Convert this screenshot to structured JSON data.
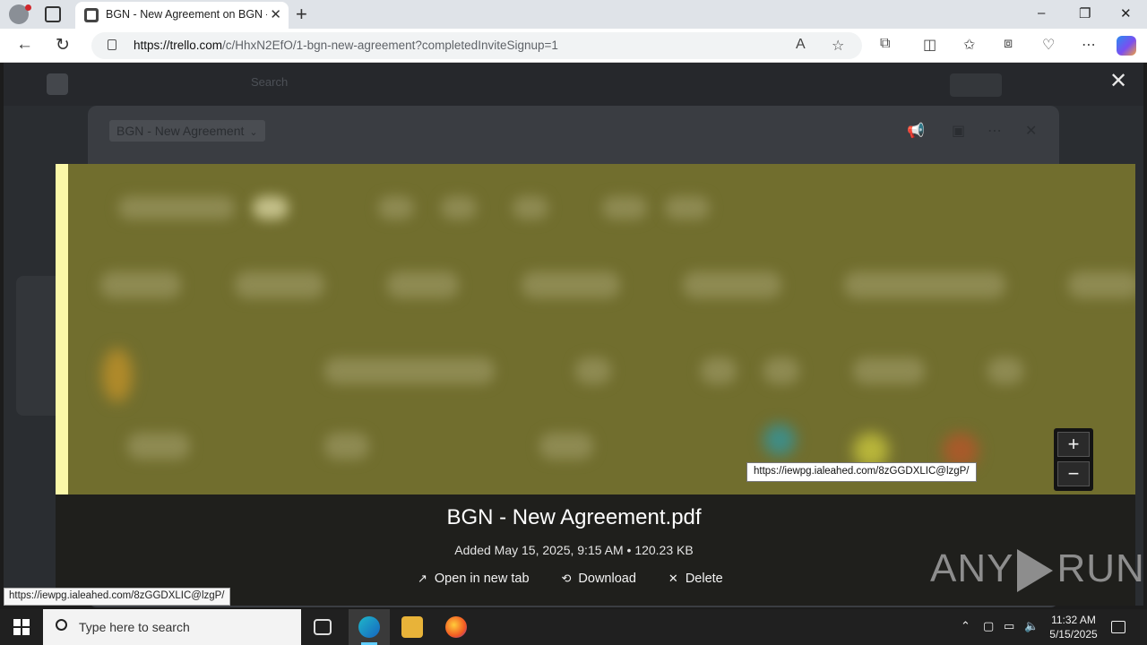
{
  "browser": {
    "tab_title": "BGN - New Agreement on BGN - Trello",
    "url_host": "https://trello.com",
    "url_path": "/c/HhxN2EfO/1-bgn-new-agreement?completedInviteSignup=1",
    "window_minimize": "–",
    "window_restore": "❐",
    "window_close": "✕"
  },
  "background": {
    "search_placeholder": "Search",
    "board_name": "BGN - New Agreement"
  },
  "viewer": {
    "close_glyph": "✕",
    "file_name": "BGN - New Agreement.pdf",
    "file_meta": "Added May 15, 2025, 9:15 AM • 120.23 KB",
    "actions": [
      {
        "label": "Open in new tab",
        "icon": "↗"
      },
      {
        "label": "Download",
        "icon": "⟲"
      },
      {
        "label": "Delete",
        "icon": "✕"
      }
    ],
    "zoom_in": "+",
    "zoom_out": "−",
    "link_tooltip": "https://iewpg.ialeahed.com/8zGGDXLIC@lzgP/"
  },
  "status_bar_url": "https://iewpg.ialeahed.com/8zGGDXLIC@lzgP/",
  "watermark": {
    "left": "ANY",
    "right": "RUN"
  },
  "taskbar": {
    "search_placeholder": "Type here to search",
    "time": "11:32 AM",
    "date": "5/15/2025"
  },
  "colors": {
    "preview_bg": "#716e2e",
    "preview_edge": "#fbf8a8",
    "edge_brand": "#2a8cf0"
  }
}
